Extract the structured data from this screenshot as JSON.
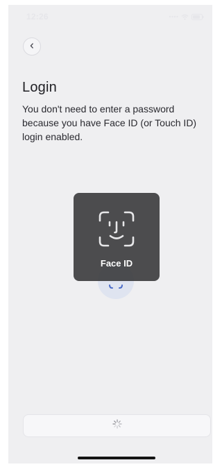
{
  "status_bar": {
    "time": "12:26",
    "icons": [
      "signal-dots-icon",
      "wifi-icon",
      "battery-icon"
    ]
  },
  "nav": {
    "back_icon": "chevron-left-icon"
  },
  "login": {
    "title": "Login",
    "description": "You don't need to enter a password because you have Face ID (or Touch ID) login enabled."
  },
  "faceid_prompt": {
    "icon": "face-id-icon",
    "label": "Face ID"
  },
  "bottom_button": {
    "state": "loading",
    "icon": "spinner-icon"
  },
  "colors": {
    "screen_bg": "#efeff1",
    "overlay_bg": "#3a3a3c",
    "accent_circle": "#dfe4f0",
    "accent_blue": "#4a6bc9"
  }
}
